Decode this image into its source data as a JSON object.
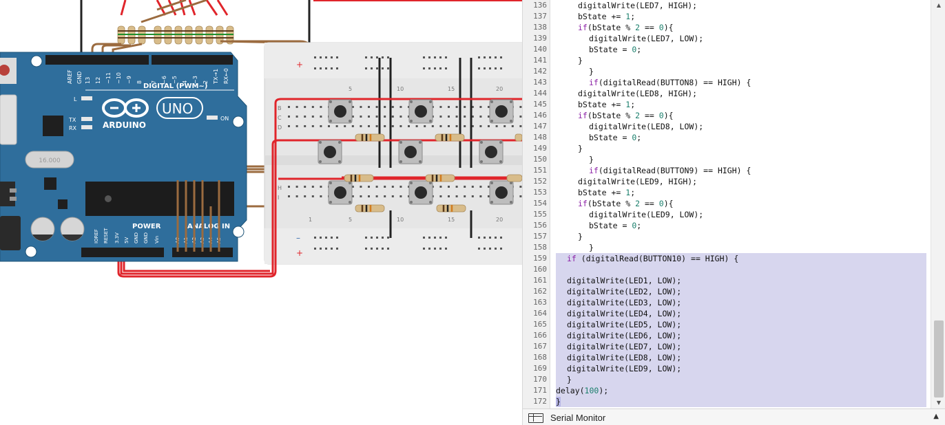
{
  "circuit": {
    "board_logo": "ARDUINO",
    "board_model": "UNO",
    "header_digital": "DIGITAL (PWM~)",
    "header_power": "POWER",
    "header_analog": "ANALOG IN",
    "pin_aref": "AREF",
    "pin_gnd": "GND",
    "digital_pins": [
      "13",
      "12",
      "~11",
      "~10",
      "~9",
      "8",
      "7",
      "~6",
      "~5",
      "4",
      "~3",
      "2",
      "TX→1",
      "RX←0"
    ],
    "power_pins": [
      "IOREF",
      "RESET",
      "3.3V",
      "5V",
      "GND",
      "GND",
      "Vin"
    ],
    "analog_pins": [
      "A0",
      "A1",
      "A2",
      "A3",
      "A4",
      "A5"
    ],
    "led_l": "L",
    "led_tx": "TX",
    "led_rx": "RX",
    "led_on": "ON",
    "crystal_label": "16.000",
    "breadboard_cols_top": [
      "5",
      "10",
      "15",
      "20"
    ],
    "breadboard_cols_bottom": [
      "1",
      "5",
      "10",
      "15",
      "20"
    ],
    "breadboard_rows": [
      "B",
      "C",
      "D",
      "H",
      "I"
    ],
    "rail_minus": "–",
    "rail_plus": "+",
    "colors": {
      "board": "#2f6e9c",
      "wire_red": "#e0252b",
      "wire_brown": "#9b6b3f",
      "wire_black": "#222222",
      "breadboard": "#e6e6e6"
    }
  },
  "editor": {
    "lines": [
      {
        "n": "136",
        "indent": 4,
        "tokens": [
          [
            "t",
            "digitalWrite(LED7, HIGH);"
          ]
        ]
      },
      {
        "n": "137",
        "indent": 4,
        "tokens": [
          [
            "t",
            "bState += "
          ],
          [
            "n",
            "1"
          ],
          [
            "t",
            ";"
          ]
        ]
      },
      {
        "n": "138",
        "indent": 4,
        "tokens": [
          [
            "k",
            "if"
          ],
          [
            "t",
            "(bState % "
          ],
          [
            "n",
            "2"
          ],
          [
            "t",
            " == "
          ],
          [
            "n",
            "0"
          ],
          [
            "t",
            "){"
          ]
        ]
      },
      {
        "n": "139",
        "indent": 6,
        "tokens": [
          [
            "t",
            "digitalWrite(LED7, LOW);"
          ]
        ]
      },
      {
        "n": "140",
        "indent": 6,
        "tokens": [
          [
            "t",
            "bState = "
          ],
          [
            "n",
            "0"
          ],
          [
            "t",
            ";"
          ]
        ]
      },
      {
        "n": "141",
        "indent": 4,
        "tokens": [
          [
            "t",
            "}"
          ]
        ]
      },
      {
        "n": "142",
        "indent": 6,
        "tokens": [
          [
            "t",
            "}"
          ]
        ]
      },
      {
        "n": "143",
        "indent": 6,
        "tokens": [
          [
            "k",
            "if"
          ],
          [
            "t",
            "(digitalRead(BUTTON8) == HIGH) {"
          ]
        ]
      },
      {
        "n": "144",
        "indent": 4,
        "tokens": [
          [
            "t",
            "digitalWrite(LED8, HIGH);"
          ]
        ]
      },
      {
        "n": "145",
        "indent": 4,
        "tokens": [
          [
            "t",
            "bState += "
          ],
          [
            "n",
            "1"
          ],
          [
            "t",
            ";"
          ]
        ]
      },
      {
        "n": "146",
        "indent": 4,
        "tokens": [
          [
            "k",
            "if"
          ],
          [
            "t",
            "(bState % "
          ],
          [
            "n",
            "2"
          ],
          [
            "t",
            " == "
          ],
          [
            "n",
            "0"
          ],
          [
            "t",
            "){"
          ]
        ]
      },
      {
        "n": "147",
        "indent": 6,
        "tokens": [
          [
            "t",
            "digitalWrite(LED8, LOW);"
          ]
        ]
      },
      {
        "n": "148",
        "indent": 6,
        "tokens": [
          [
            "t",
            "bState = "
          ],
          [
            "n",
            "0"
          ],
          [
            "t",
            ";"
          ]
        ]
      },
      {
        "n": "149",
        "indent": 4,
        "tokens": [
          [
            "t",
            "}"
          ]
        ]
      },
      {
        "n": "150",
        "indent": 6,
        "tokens": [
          [
            "t",
            "}"
          ]
        ]
      },
      {
        "n": "151",
        "indent": 6,
        "tokens": [
          [
            "k",
            "if"
          ],
          [
            "t",
            "(digitalRead(BUTTON9) == HIGH) {"
          ]
        ]
      },
      {
        "n": "152",
        "indent": 4,
        "tokens": [
          [
            "t",
            "digitalWrite(LED9, HIGH);"
          ]
        ]
      },
      {
        "n": "153",
        "indent": 4,
        "tokens": [
          [
            "t",
            "bState += "
          ],
          [
            "n",
            "1"
          ],
          [
            "t",
            ";"
          ]
        ]
      },
      {
        "n": "154",
        "indent": 4,
        "tokens": [
          [
            "k",
            "if"
          ],
          [
            "t",
            "(bState % "
          ],
          [
            "n",
            "2"
          ],
          [
            "t",
            " == "
          ],
          [
            "n",
            "0"
          ],
          [
            "t",
            "){"
          ]
        ]
      },
      {
        "n": "155",
        "indent": 6,
        "tokens": [
          [
            "t",
            "digitalWrite(LED9, LOW);"
          ]
        ]
      },
      {
        "n": "156",
        "indent": 6,
        "tokens": [
          [
            "t",
            "bState = "
          ],
          [
            "n",
            "0"
          ],
          [
            "t",
            ";"
          ]
        ]
      },
      {
        "n": "157",
        "indent": 4,
        "tokens": [
          [
            "t",
            "}"
          ]
        ]
      },
      {
        "n": "158",
        "indent": 6,
        "tokens": [
          [
            "t",
            "}"
          ]
        ]
      },
      {
        "n": "159",
        "indent": 2,
        "hl": true,
        "tokens": [
          [
            "k",
            "if"
          ],
          [
            "t",
            " (digitalRead(BUTTON10) == HIGH) {"
          ]
        ]
      },
      {
        "n": "160",
        "indent": 0,
        "hl": true,
        "tokens": []
      },
      {
        "n": "161",
        "indent": 2,
        "hl": true,
        "tokens": [
          [
            "t",
            "digitalWrite(LED1, LOW);"
          ]
        ]
      },
      {
        "n": "162",
        "indent": 2,
        "hl": true,
        "tokens": [
          [
            "t",
            "digitalWrite(LED2, LOW);"
          ]
        ]
      },
      {
        "n": "163",
        "indent": 2,
        "hl": true,
        "tokens": [
          [
            "t",
            "digitalWrite(LED3, LOW);"
          ]
        ]
      },
      {
        "n": "164",
        "indent": 2,
        "hl": true,
        "tokens": [
          [
            "t",
            "digitalWrite(LED4, LOW);"
          ]
        ]
      },
      {
        "n": "165",
        "indent": 2,
        "hl": true,
        "tokens": [
          [
            "t",
            "digitalWrite(LED5, LOW);"
          ]
        ]
      },
      {
        "n": "166",
        "indent": 2,
        "hl": true,
        "tokens": [
          [
            "t",
            "digitalWrite(LED6, LOW);"
          ]
        ]
      },
      {
        "n": "167",
        "indent": 2,
        "hl": true,
        "tokens": [
          [
            "t",
            "digitalWrite(LED7, LOW);"
          ]
        ]
      },
      {
        "n": "168",
        "indent": 2,
        "hl": true,
        "tokens": [
          [
            "t",
            "digitalWrite(LED8, LOW);"
          ]
        ]
      },
      {
        "n": "169",
        "indent": 2,
        "hl": true,
        "tokens": [
          [
            "t",
            "digitalWrite(LED9, LOW);"
          ]
        ]
      },
      {
        "n": "170",
        "indent": 2,
        "hl": true,
        "tokens": [
          [
            "t",
            "}"
          ]
        ]
      },
      {
        "n": "171",
        "indent": 0,
        "hl": true,
        "tokens": [
          [
            "t",
            "delay("
          ],
          [
            "n",
            "100"
          ],
          [
            "t",
            ");"
          ]
        ]
      },
      {
        "n": "172",
        "indent": 0,
        "hl": true,
        "cursor": true,
        "tokens": [
          [
            "t",
            "}"
          ]
        ]
      }
    ],
    "serial_monitor_label": "Serial Monitor",
    "serial_toggle_icon": "▲",
    "scroll_up_icon": "▲",
    "scroll_down_icon": "▼",
    "colors": {
      "keyword": "#8a1fa5",
      "number": "#1a7f6c",
      "selection": "#d7d6ee",
      "gutter": "#f0f0f0"
    }
  }
}
